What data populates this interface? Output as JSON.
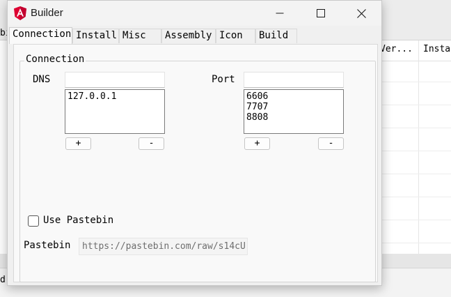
{
  "background": {
    "left_clipped_text": "bı",
    "columns": [
      "Ver...",
      "Insta"
    ],
    "status_clipped_text": "d"
  },
  "window": {
    "title": "Builder",
    "icon": "angular-shield-icon",
    "accent_color": "#dd0031",
    "controls": [
      "minimize-icon",
      "maximize-icon",
      "close-icon"
    ]
  },
  "tabs": [
    {
      "label": "Connection",
      "active": true
    },
    {
      "label": "Install",
      "active": false
    },
    {
      "label": "Misc",
      "active": false
    },
    {
      "label": "Assembly",
      "active": false
    },
    {
      "label": "Icon",
      "active": false
    },
    {
      "label": "Build",
      "active": false
    }
  ],
  "connection": {
    "group_label": "Connection",
    "dns": {
      "label": "DNS",
      "input_value": "",
      "entries": [
        "127.0.0.1"
      ],
      "add_label": "+",
      "remove_label": "-"
    },
    "port": {
      "label": "Port",
      "input_value": "",
      "entries": [
        "6606",
        "7707",
        "8808"
      ],
      "add_label": "+",
      "remove_label": "-"
    },
    "use_pastebin": {
      "label": "Use Pastebin",
      "checked": false
    },
    "pastebin": {
      "label": "Pastebin",
      "value": "https://pastebin.com/raw/s14cU"
    }
  }
}
